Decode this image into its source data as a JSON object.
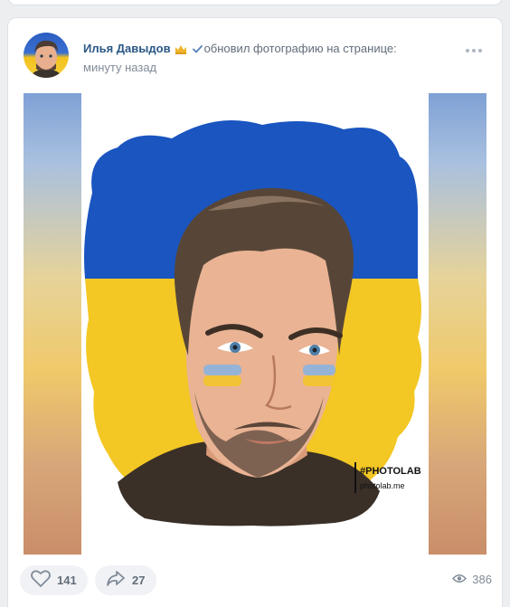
{
  "post": {
    "author": "Илья Давыдов",
    "action": "обновил фотографию на странице:",
    "time": "минуту назад",
    "photo": {
      "watermark_tag": "#PHOTOLAB",
      "watermark_site": "photolab.me"
    },
    "footer": {
      "likes": "141",
      "shares": "27",
      "views": "386"
    }
  },
  "colors": {
    "link": "#2a5885",
    "flag_blue": "#1a55c0",
    "flag_yellow": "#f3c724",
    "verified": "#5181b8"
  },
  "icons": {
    "crown": "crown-icon",
    "verified": "check-icon",
    "more": "more-dots-icon",
    "like": "heart-icon",
    "share": "share-arrow-icon",
    "views": "eye-icon"
  }
}
